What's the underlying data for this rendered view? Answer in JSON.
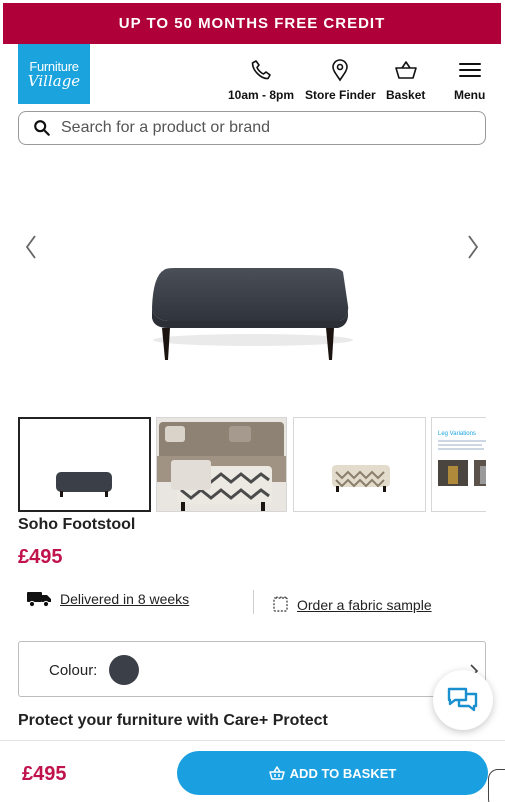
{
  "promo": {
    "text": "UP TO 50 MONTHS FREE CREDIT",
    "color": "#b0003a"
  },
  "logo": {
    "line1": "Furniture",
    "line2": "Village",
    "color": "#1aa3dd"
  },
  "nav": {
    "phone": {
      "label": "10am - 8pm",
      "icon": "phone-icon"
    },
    "store": {
      "label": "Store Finder",
      "icon": "map-pin-icon"
    },
    "basket": {
      "label": "Basket",
      "icon": "basket-icon"
    },
    "menu": {
      "label": "Menu",
      "icon": "hamburger-icon"
    }
  },
  "search": {
    "placeholder": "Search for a product or brand",
    "value": ""
  },
  "gallery": {
    "prev_icon": "chevron-left-icon",
    "next_icon": "chevron-right-icon",
    "thumb4_title": "Leg Variations"
  },
  "product": {
    "title": "Soho Footstool",
    "price": "£495"
  },
  "delivery": {
    "text": "Delivered in 8 weeks",
    "icon": "truck-icon"
  },
  "fabric": {
    "text": "Order a fabric sample",
    "icon": "fabric-swatch-icon"
  },
  "colour": {
    "label": "Colour:",
    "swatch_color": "#3b3f47"
  },
  "care": {
    "heading": "Protect your furniture with Care+ Protect"
  },
  "sticky": {
    "price": "£495",
    "add_label": "ADD TO BASKET",
    "button_color": "#1aa0e0"
  },
  "accent_price_color": "#c0134c"
}
